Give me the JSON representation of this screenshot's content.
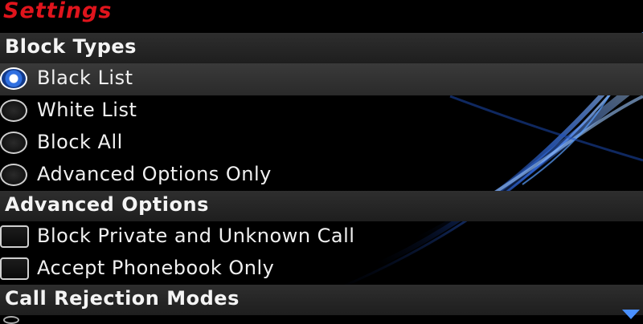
{
  "app": {
    "title": "Settings"
  },
  "sections": {
    "block_types": {
      "header": "Block Types",
      "options": [
        {
          "label": "Black List",
          "selected": true
        },
        {
          "label": "White List",
          "selected": false
        },
        {
          "label": "Block All",
          "selected": false
        },
        {
          "label": "Advanced Options Only",
          "selected": false
        }
      ]
    },
    "advanced_options": {
      "header": "Advanced Options",
      "checkboxes": [
        {
          "label": "Block Private and Unknown Call",
          "checked": false
        },
        {
          "label": "Accept Phonebook Only",
          "checked": false
        }
      ]
    },
    "call_rejection": {
      "header": "Call Rejection Modes"
    }
  },
  "colors": {
    "title": "#e0141c",
    "accent": "#2f6fe0",
    "background": "#000000"
  },
  "icons": {
    "scroll": "chevron-down-icon"
  }
}
